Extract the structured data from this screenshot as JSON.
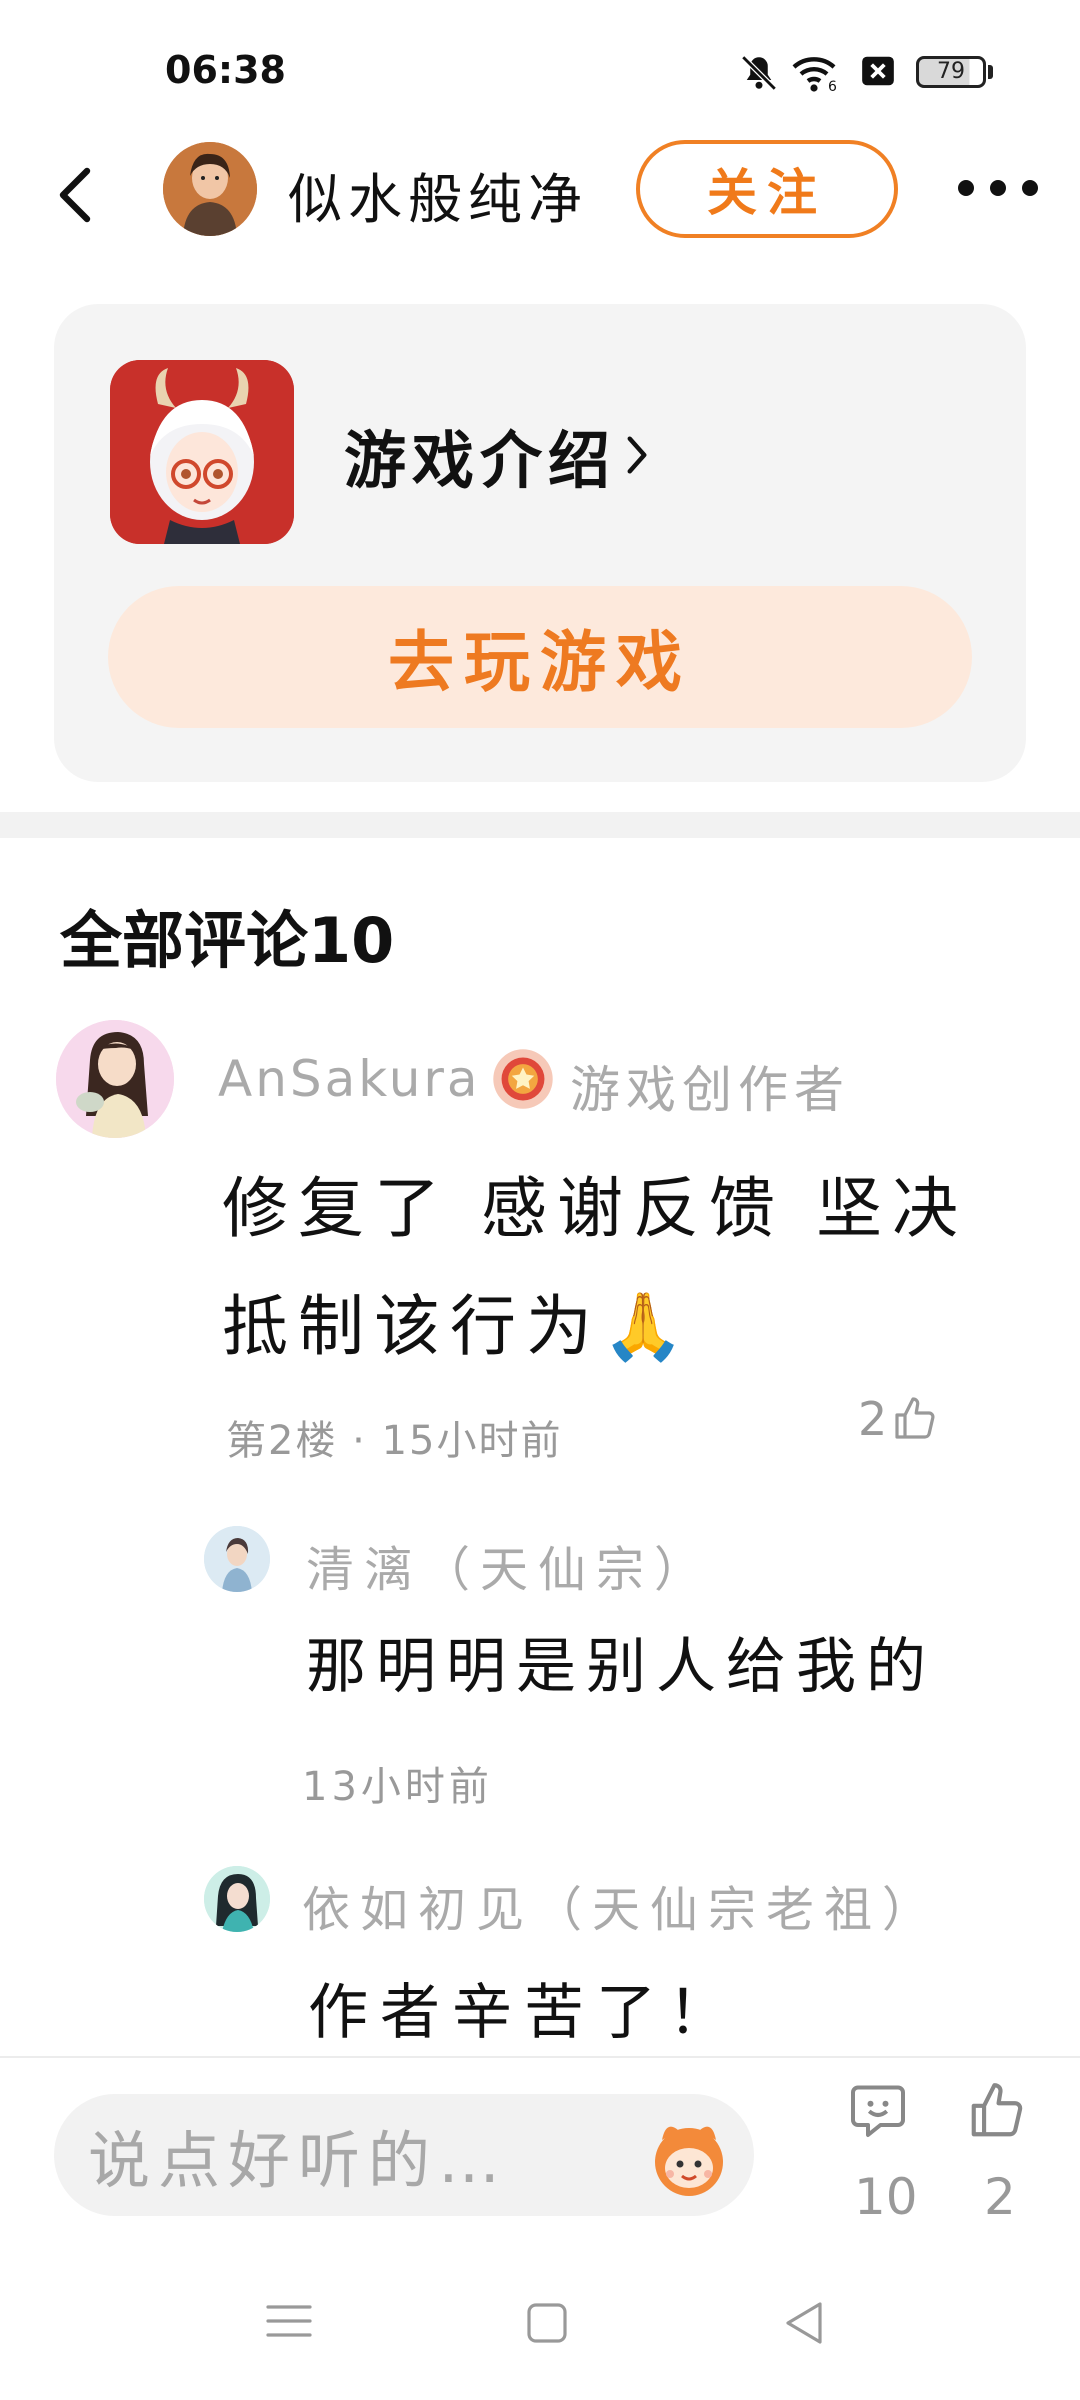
{
  "status_bar": {
    "time": "06:38",
    "battery": "79",
    "icons": [
      "mute-icon",
      "wifi-icon",
      "no-sim-icon",
      "battery-icon"
    ]
  },
  "header": {
    "author_name": "似水般纯净",
    "follow_label": "关注",
    "back_icon": "chevron-left-icon",
    "more_icon": "more-dots-icon"
  },
  "game": {
    "intro_label": "游戏介绍",
    "play_label": "去玩游戏"
  },
  "comments": {
    "title": "全部评论10",
    "items": [
      {
        "user": "AnSakura",
        "role": "游戏创作者",
        "text": "修复了 感谢反馈 坚决抵制该行为🙏",
        "meta": "第2楼 · 15小时前",
        "likes": "2",
        "replies": [
          {
            "user": "清漓（天仙宗）",
            "text": "那明明是别人给我的",
            "meta": "13小时前"
          },
          {
            "user": "依如初见（天仙宗老祖）",
            "text": "作者辛苦了！"
          }
        ]
      }
    ]
  },
  "bottom_bar": {
    "input_placeholder": "说点好听的…",
    "comment_count": "10",
    "like_count": "2"
  },
  "colors": {
    "accent": "#f07a1a",
    "play_bg": "#fde9dc",
    "card_bg": "#f4f4f4",
    "muted": "#aaaaaa"
  }
}
